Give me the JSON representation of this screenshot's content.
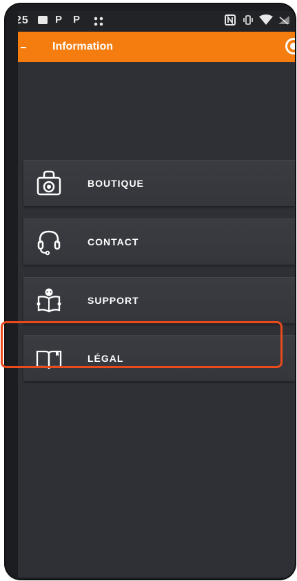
{
  "status_bar": {
    "time": "25",
    "left_icons": [
      "image-icon",
      "p-icon",
      "p-icon",
      "grid-icon"
    ],
    "right_icons": [
      "nfc-icon",
      "vibrate-icon",
      "wifi-icon",
      "battery-icon"
    ]
  },
  "app_bar": {
    "title": "Information",
    "accent_color": "#f57d0f"
  },
  "menu": {
    "items": [
      {
        "label": "BOUTIQUE",
        "icon": "shopping-bag-icon"
      },
      {
        "label": "CONTACT",
        "icon": "headset-icon"
      },
      {
        "label": "SUPPORT",
        "icon": "book-reader-icon"
      },
      {
        "label": "LÉGAL",
        "icon": "open-book-icon"
      }
    ],
    "highlighted_item": "LÉGAL",
    "highlight_color": "#ea4a1c"
  }
}
